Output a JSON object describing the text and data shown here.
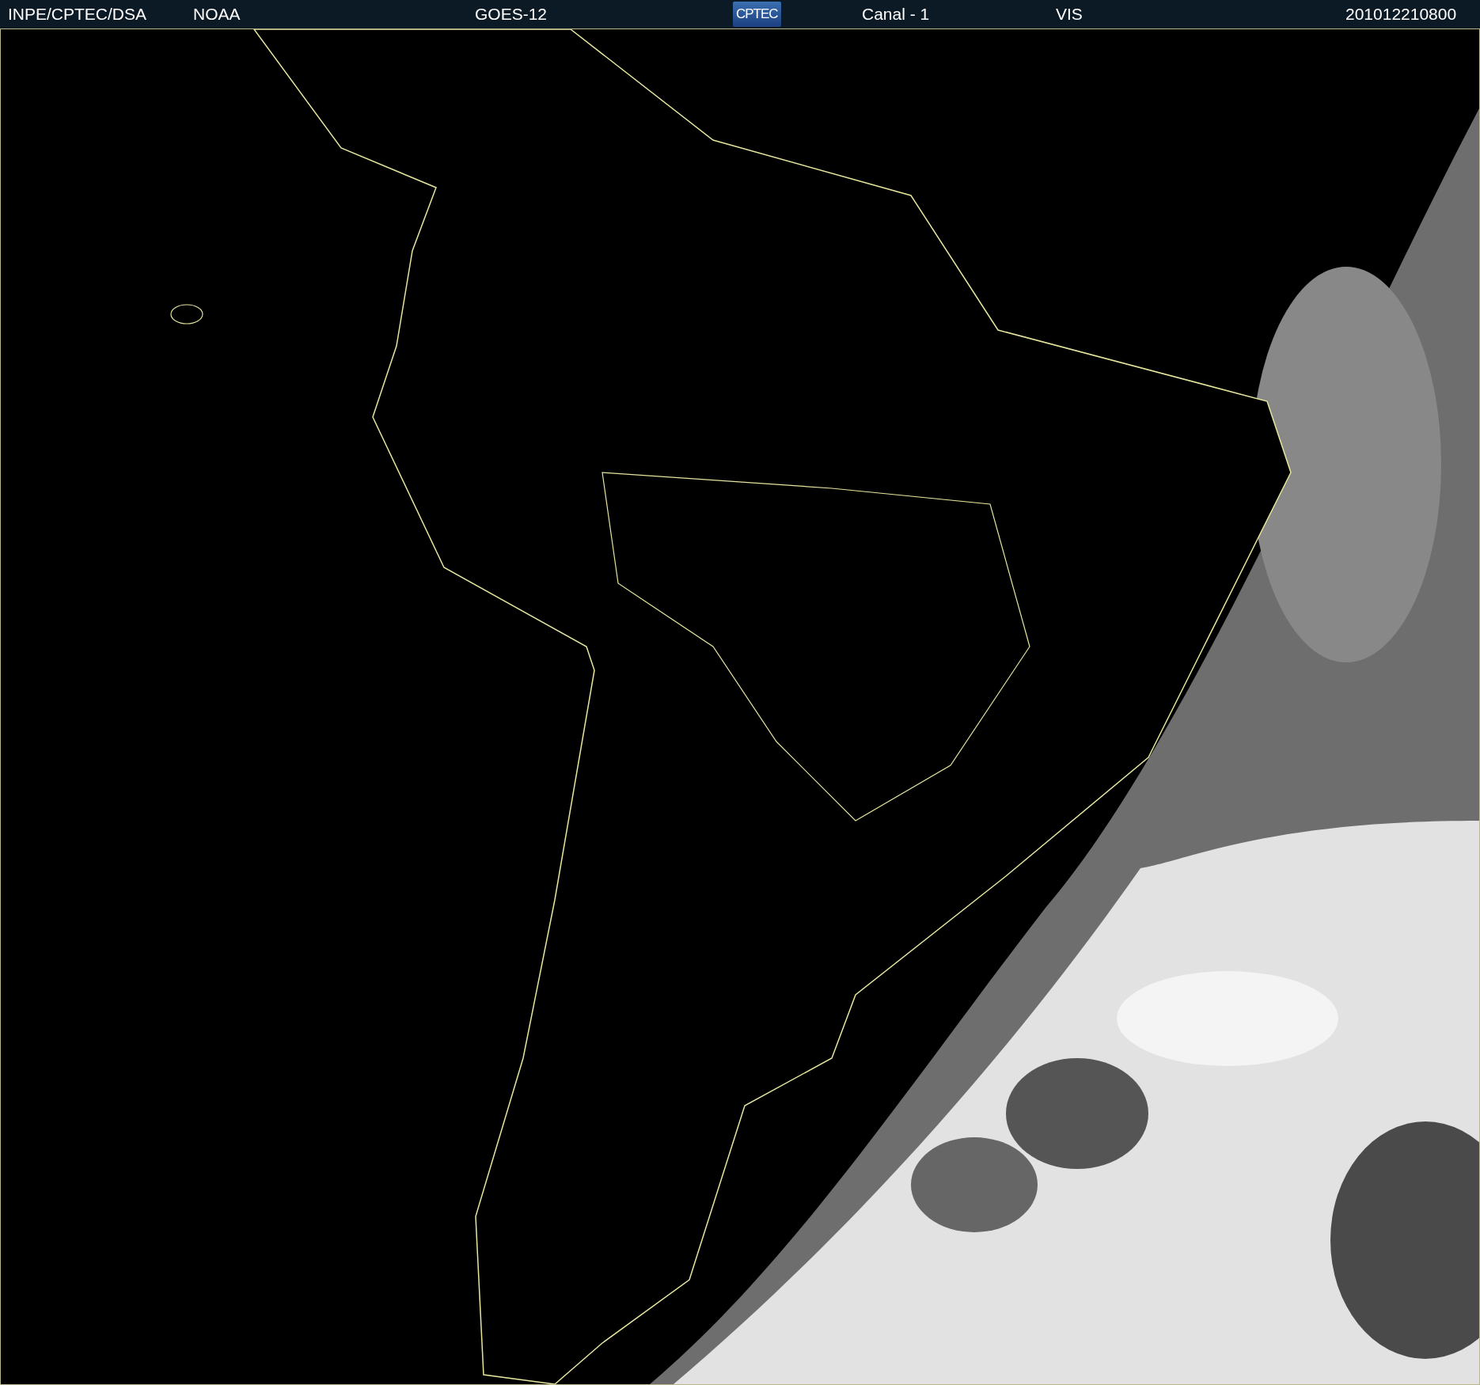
{
  "header": {
    "items": [
      {
        "kind": "text",
        "text": "INPE/CPTEC/DSA"
      },
      {
        "kind": "text",
        "text": "NOAA"
      },
      {
        "kind": "text",
        "text": "GOES-12"
      },
      {
        "kind": "logo",
        "text": "CPTEC"
      },
      {
        "kind": "text",
        "text": "Canal - 1"
      },
      {
        "kind": "text",
        "text": "VIS"
      },
      {
        "kind": "text",
        "text": "201012210800"
      }
    ]
  }
}
